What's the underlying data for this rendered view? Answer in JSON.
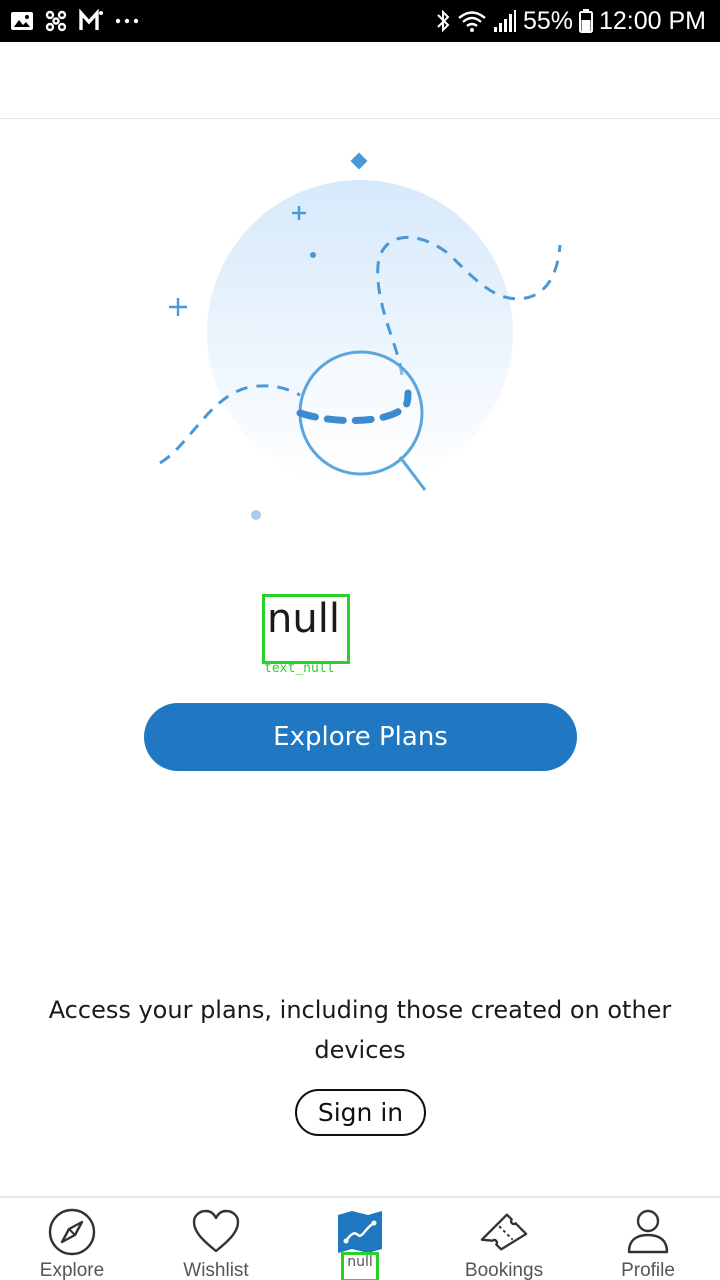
{
  "status_bar": {
    "battery": "55%",
    "time": "12:00 PM"
  },
  "main": {
    "placeholder_text": "null",
    "placeholder_tag": "text_null",
    "explore_button": "Explore Plans",
    "access_text": "Access your plans, including those created on other devices",
    "sign_in_button": "Sign in"
  },
  "bottom_nav": {
    "items": [
      {
        "label": "Explore",
        "icon": "compass-icon"
      },
      {
        "label": "Wishlist",
        "icon": "heart-icon"
      },
      {
        "label": "null",
        "icon": "map-icon",
        "active": true
      },
      {
        "label": "Bookings",
        "icon": "ticket-icon"
      },
      {
        "label": "Profile",
        "icon": "person-icon"
      }
    ]
  },
  "colors": {
    "accent": "#1f78c1",
    "illustration": "#4a98d8",
    "debug_box": "#2bd12b"
  }
}
